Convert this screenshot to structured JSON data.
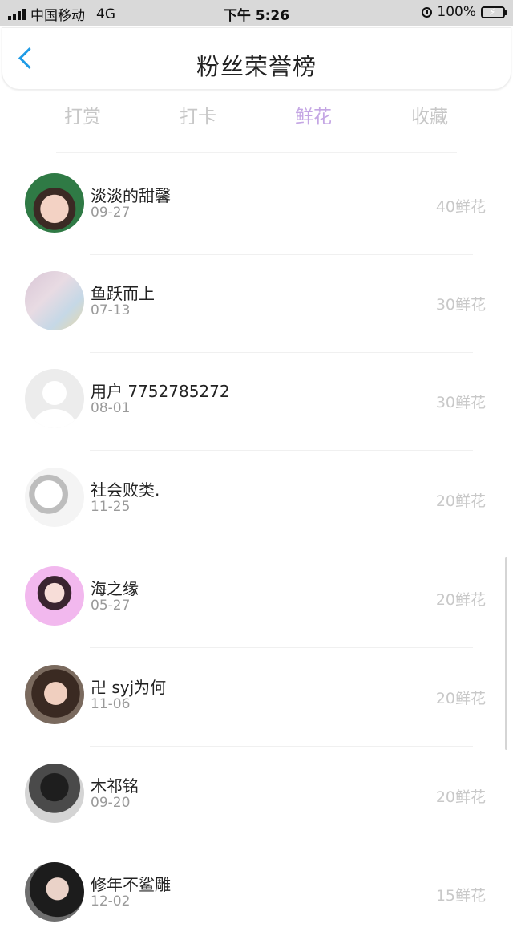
{
  "status_bar": {
    "carrier": "中国移动",
    "network": "4G",
    "time": "下午 5:26",
    "battery": "100%",
    "battery_level": 1.0,
    "icons": [
      "signal-icon",
      "alarm-icon",
      "battery-icon"
    ]
  },
  "nav": {
    "back_icon": "chevron-left-icon",
    "title": "粉丝荣誉榜"
  },
  "tabs": [
    {
      "label": "打赏"
    },
    {
      "label": "打卡"
    },
    {
      "label": "鲜花",
      "active": true
    },
    {
      "label": "收藏"
    }
  ],
  "colors": {
    "accent": "#c4a6e4",
    "back": "#1e9be6",
    "status_bar_bg": "#d9d9d9",
    "battery_green": "#4cd964"
  },
  "fans": [
    {
      "name": "淡淡的甜馨",
      "date": "09-27",
      "amount": "40鲜花"
    },
    {
      "name": "鱼跃而上",
      "date": "07-13",
      "amount": "30鲜花"
    },
    {
      "name": "用户 7752785272",
      "date": "08-01",
      "amount": "30鲜花"
    },
    {
      "name": "社会败类.",
      "date": "11-25",
      "amount": "20鲜花"
    },
    {
      "name": "海之缘",
      "date": "05-27",
      "amount": "20鲜花"
    },
    {
      "name": "卍 syj为何",
      "date": "11-06",
      "amount": "20鲜花"
    },
    {
      "name": "木祁铭",
      "date": "09-20",
      "amount": "20鲜花"
    },
    {
      "name": "修年不鲨雕",
      "date": "12-02",
      "amount": "15鲜花"
    }
  ]
}
